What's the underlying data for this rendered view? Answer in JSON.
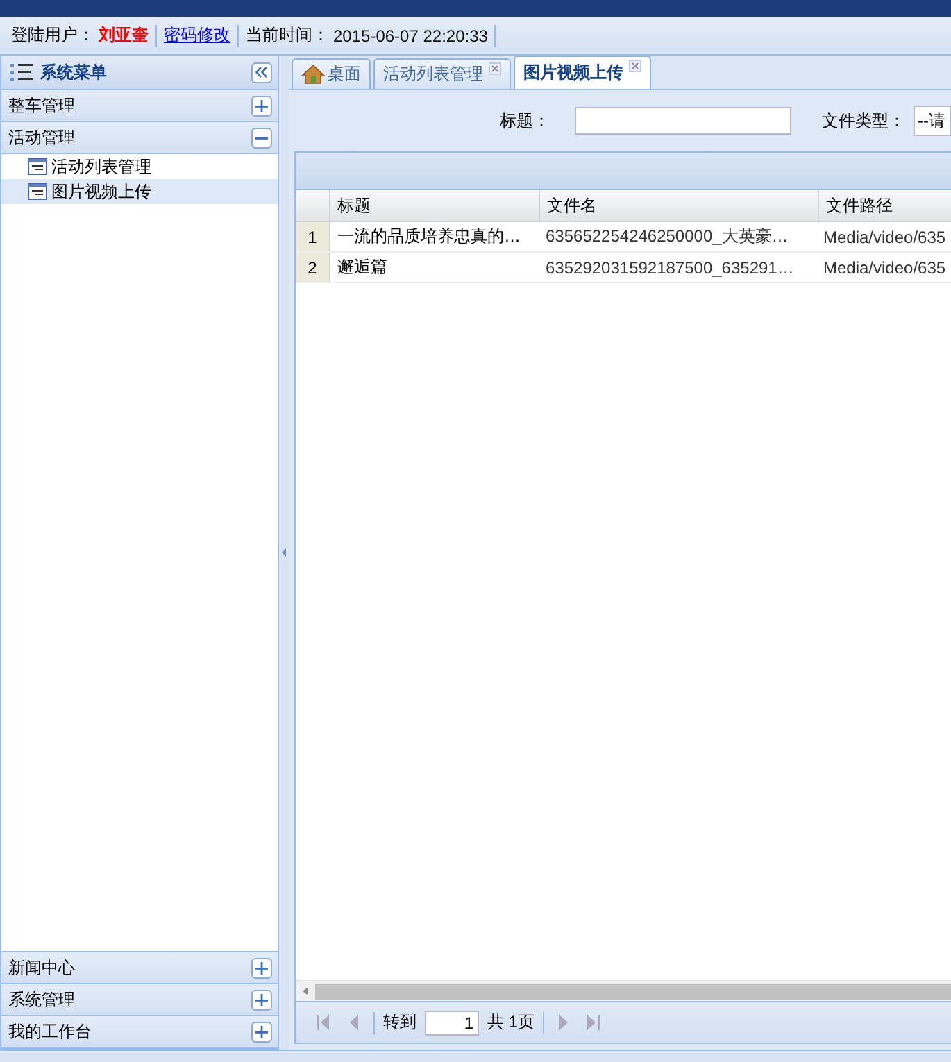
{
  "info_bar": {
    "user_label": "登陆用户：",
    "user_name": "刘亚奎",
    "password_link": "密码修改",
    "time_label": "当前时间：",
    "time": "2015-06-07 22:20:33"
  },
  "sidebar": {
    "title": "系统菜单",
    "sections": [
      {
        "label": "整车管理",
        "expanded": false
      },
      {
        "label": "活动管理",
        "expanded": true,
        "children": [
          {
            "label": "活动列表管理",
            "selected": false
          },
          {
            "label": "图片视频上传",
            "selected": true
          }
        ]
      },
      {
        "label": "新闻中心",
        "expanded": false
      },
      {
        "label": "系统管理",
        "expanded": false
      },
      {
        "label": "我的工作台",
        "expanded": false
      }
    ]
  },
  "tabs": [
    {
      "label": "桌面",
      "kind": "home",
      "closable": false,
      "selected": false
    },
    {
      "label": "活动列表管理",
      "kind": "page",
      "closable": true,
      "selected": false
    },
    {
      "label": "图片视频上传",
      "kind": "page",
      "closable": true,
      "selected": true
    }
  ],
  "filters": [
    {
      "label": "标题：",
      "kind": "text"
    },
    {
      "label": "文件类型：",
      "kind": "select",
      "value": "--请"
    }
  ],
  "grid": {
    "columns": [
      "标题",
      "文件名",
      "文件路径"
    ],
    "rows": [
      {
        "number": "1",
        "cells": [
          "一流的品质培养忠真的…",
          "635652254246250000_大英豪…",
          "Media/video/635"
        ]
      },
      {
        "number": "2",
        "cells": [
          "邂逅篇",
          "635292031592187500_635291…",
          "Media/video/635"
        ]
      }
    ]
  },
  "pager": {
    "goto_label": "转到",
    "page": "1",
    "total": "共 1页"
  }
}
